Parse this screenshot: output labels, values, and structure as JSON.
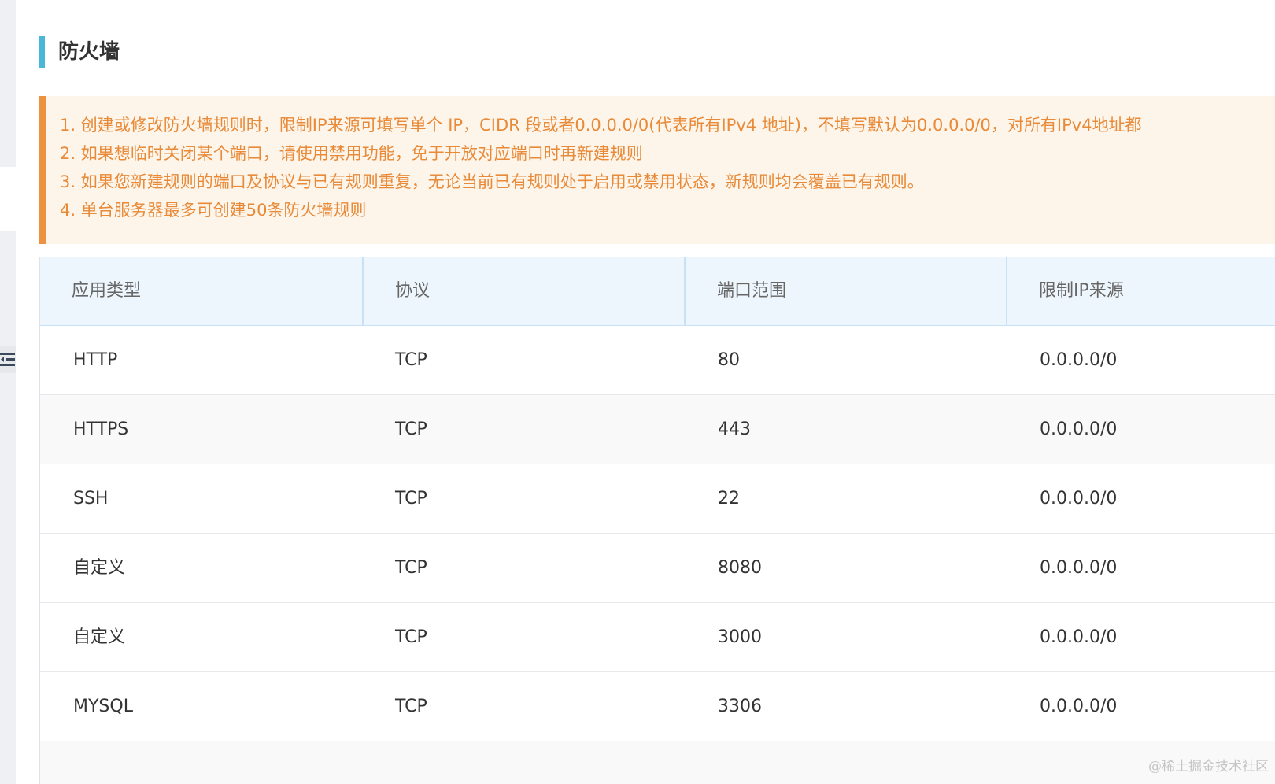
{
  "page": {
    "title": "防火墙"
  },
  "notice": {
    "lines": [
      "1. 创建或修改防火墙规则时，限制IP来源可填写单个 IP，CIDR 段或者0.0.0.0/0(代表所有IPv4 地址)，不填写默认为0.0.0.0/0，对所有IPv4地址都",
      "2. 如果想临时关闭某个端口，请使用禁用功能，免于开放对应端口时再新建规则",
      "3. 如果您新建规则的端口及协议与已有规则重复，无论当前已有规则处于启用或禁用状态，新规则均会覆盖已有规则。",
      "4. 单台服务器最多可创建50条防火墙规则"
    ]
  },
  "table": {
    "columns": [
      "应用类型",
      "协议",
      "端口范围",
      "限制IP来源"
    ],
    "rows": [
      {
        "app": "HTTP",
        "protocol": "TCP",
        "port": "80",
        "source": "0.0.0.0/0"
      },
      {
        "app": "HTTPS",
        "protocol": "TCP",
        "port": "443",
        "source": "0.0.0.0/0"
      },
      {
        "app": "SSH",
        "protocol": "TCP",
        "port": "22",
        "source": "0.0.0.0/0"
      },
      {
        "app": "自定义",
        "protocol": "TCP",
        "port": "8080",
        "source": "0.0.0.0/0"
      },
      {
        "app": "自定义",
        "protocol": "TCP",
        "port": "3000",
        "source": "0.0.0.0/0"
      },
      {
        "app": "MYSQL",
        "protocol": "TCP",
        "port": "3306",
        "source": "0.0.0.0/0"
      }
    ]
  },
  "watermark": "@稀土掘金技术社区",
  "colors": {
    "accent": "#4ab7d8",
    "notice_border": "#ec9240",
    "notice_text": "#e88a38",
    "notice_bg": "#fdf4ea",
    "header_bg": "#eef6fd"
  },
  "icons": {
    "sidebar_toggle": "menu-collapse-icon"
  }
}
